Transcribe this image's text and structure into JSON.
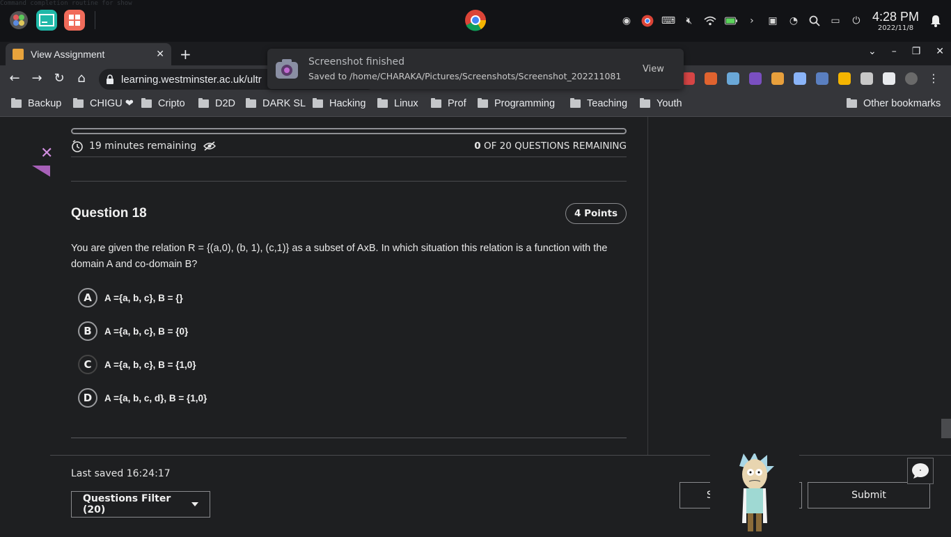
{
  "taskbar": {
    "clock_time": "4:28 PM",
    "clock_date": "2022/11/8",
    "background_text": "Command completion routine for show"
  },
  "browser": {
    "tab_title": "View Assignment",
    "url": "learning.westminster.ac.uk/ultr",
    "bookmarks": [
      "Backup",
      "CHIGU ❤",
      "Cripto",
      "D2D",
      "DARK SL",
      "Hacking",
      "Linux",
      "Prof",
      "Programming",
      "Teaching",
      "Youth"
    ],
    "other_bookmarks": "Other bookmarks"
  },
  "notification": {
    "heading": "Screenshot finished",
    "body": "Saved to /home/CHARAKA/Pictures/Screenshots/Screenshot_202211081...",
    "action": "View"
  },
  "assignment": {
    "time_remaining": "19 minutes remaining",
    "remaining_count": "0",
    "remaining_suffix": "OF 20 QUESTIONS REMAINING",
    "question_title": "Question 18",
    "points": "4 Points",
    "question_text": "You are given the relation R = {(a,0), (b, 1), (c,1)} as a subset of AxB. In which situation this relation is a function with the domain A and co-domain B?",
    "options": [
      {
        "letter": "A",
        "text": "A ={a, b, c}, B = {}"
      },
      {
        "letter": "B",
        "text": "A ={a, b, c}, B = {0}"
      },
      {
        "letter": "C",
        "text": "A ={a, b, c}, B = {1,0}"
      },
      {
        "letter": "D",
        "text": "A ={a, b, c, d}, B = {1,0}"
      }
    ],
    "progress": 1.0
  },
  "footer": {
    "last_saved": "Last saved 16:24:17",
    "questions_filter": "Questions Filter (20)",
    "save_partial": "S",
    "submit": "Submit"
  },
  "colors": {
    "accent_close": "#d18ee0",
    "accent_triangle": "#a760b8"
  }
}
